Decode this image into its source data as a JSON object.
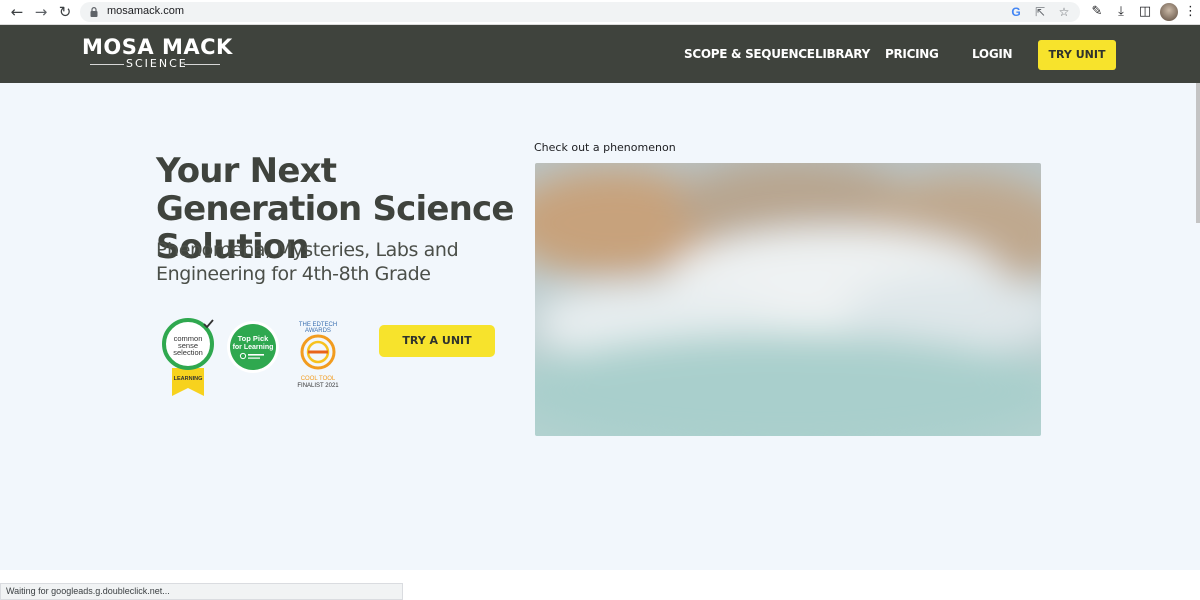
{
  "browser": {
    "url": "mosamack.com",
    "icons": [
      "back-arrow-icon",
      "forward-arrow-icon",
      "reload-icon",
      "lock-icon",
      "google-icon",
      "share-icon",
      "star-icon",
      "extensions-icon",
      "download-icon",
      "sidebar-icon",
      "menu-icon"
    ]
  },
  "header": {
    "logo_main": "MOSA MACK",
    "logo_sub": "SCIENCE",
    "nav": {
      "scope": "SCOPE & SEQUENCE",
      "library": "LIBRARY",
      "pricing": "PRICING",
      "login": "LOGIN"
    },
    "try_label": "TRY UNIT"
  },
  "hero": {
    "title": "Your Next Generation Science Solution",
    "subtitle": "Phenomena, Mysteries, Labs and Engineering for 4th-8th Grade",
    "cta": "TRY A UNIT"
  },
  "badges": {
    "common_sense": {
      "line1": "common",
      "line2": "sense",
      "line3": "selection",
      "ribbon": "LEARNING"
    },
    "top_pick": {
      "line1": "Top Pick",
      "line2": "for Learning"
    },
    "edtech": {
      "line1": "THE EDTECH",
      "line2": "AWARDS",
      "line3": "COOL TOOL",
      "line4": "FINALIST 2021"
    }
  },
  "video": {
    "label": "Check out a phenomenon"
  },
  "status": {
    "text": "Waiting for googleads.g.doubleclick.net..."
  },
  "colors": {
    "header_bg": "#3f433d",
    "accent_yellow": "#f7e32c",
    "page_bg": "#f2f7fc",
    "badge_green": "#2fa84f",
    "badge_orange": "#f29c1f"
  }
}
